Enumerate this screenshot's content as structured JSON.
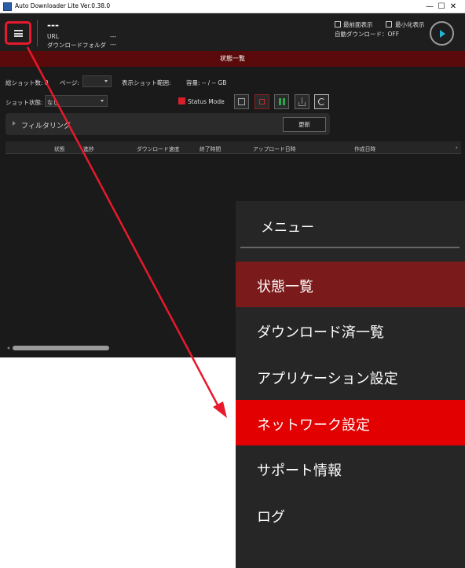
{
  "window": {
    "title": "Auto Downloader Lite Ver.0.38.0",
    "min": "—",
    "max": "☐",
    "close": "✕"
  },
  "header": {
    "job_title": "---",
    "url_label": "URL",
    "url_value": "---",
    "folder_label": "ダウンロードフォルダ",
    "folder_value": "---",
    "opt_topmost": "最前面表示",
    "opt_minimized": "最小化表示",
    "auto_download": "自動ダウンロード：OFF"
  },
  "status_title": "状態一覧",
  "controls": {
    "total_label": "総ショット数: 0",
    "page_label": "ページ:",
    "range_label": "表示ショット範囲:",
    "capacity_label": "容量: -- / -- GB",
    "shot_state_label": "ショット状態:",
    "shot_state_value": "なし",
    "status_mode": "Status Mode"
  },
  "filter": {
    "label": "フィルタリング",
    "update": "更新"
  },
  "table": {
    "headers": [
      "状態",
      "進捗",
      "ダウンロード速度",
      "終了時間",
      "アップロード日時",
      "作成日時"
    ],
    "more": "›"
  },
  "menu": {
    "heading": "メニュー",
    "items": [
      {
        "label": "状態一覧",
        "state": "active"
      },
      {
        "label": "ダウンロード済一覧",
        "state": "normal"
      },
      {
        "label": "アプリケーション設定",
        "state": "normal"
      },
      {
        "label": "ネットワーク設定",
        "state": "highlight"
      },
      {
        "label": "サポート情報",
        "state": "normal"
      },
      {
        "label": "ログ",
        "state": "normal"
      }
    ]
  },
  "colors": {
    "accent": "#e8192c",
    "active_item": "#7a1a1a",
    "highlight_item": "#e30000",
    "status_bar": "#5a0a0a"
  },
  "icons": [
    "hamburger-icon",
    "play-icon",
    "film-icon",
    "stop-icon",
    "pause-icon",
    "download-icon",
    "refresh-icon"
  ]
}
